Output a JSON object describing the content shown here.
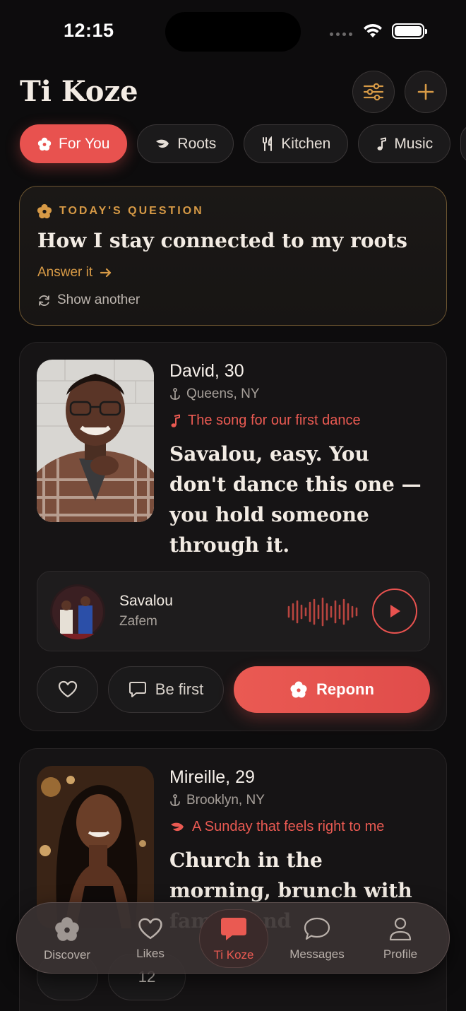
{
  "status": {
    "time": "12:15"
  },
  "header": {
    "title": "Ti Koze"
  },
  "chips": [
    {
      "label": "For You",
      "icon": "flower-icon",
      "active": true
    },
    {
      "label": "Roots",
      "icon": "leaf-icon",
      "active": false
    },
    {
      "label": "Kitchen",
      "icon": "utensils-icon",
      "active": false
    },
    {
      "label": "Music",
      "icon": "music-note-icon",
      "active": false
    }
  ],
  "question": {
    "label": "TODAY'S QUESTION",
    "text": "How I stay connected to my roots",
    "answer_label": "Answer it",
    "another_label": "Show another"
  },
  "profiles": [
    {
      "name": "David, 30",
      "location": "Queens, NY",
      "prompt": "The song for our first dance",
      "prompt_icon": "music-note-icon",
      "answer": "Savalou, easy. You don't dance this one — you hold someone through it.",
      "song": {
        "title": "Savalou",
        "artist": "Zafem"
      },
      "comment_label": "Be first",
      "reply_label": "Reponn"
    },
    {
      "name": "Mireille, 29",
      "location": "Brooklyn, NY",
      "prompt": "A Sunday that feels right to me",
      "prompt_icon": "leaf-icon",
      "answer": "Church in the morning, brunch with family, and",
      "comment_count": "12"
    }
  ],
  "nav": [
    {
      "label": "Discover",
      "icon": "hibiscus-icon"
    },
    {
      "label": "Likes",
      "icon": "heart-icon"
    },
    {
      "label": "Ti Koze",
      "icon": "chat-bubble-icon",
      "active": true
    },
    {
      "label": "Messages",
      "icon": "message-circle-icon"
    },
    {
      "label": "Profile",
      "icon": "person-icon"
    }
  ],
  "colors": {
    "accent": "#e8524f",
    "gold": "#d79a46",
    "background": "#0d0c0d"
  }
}
